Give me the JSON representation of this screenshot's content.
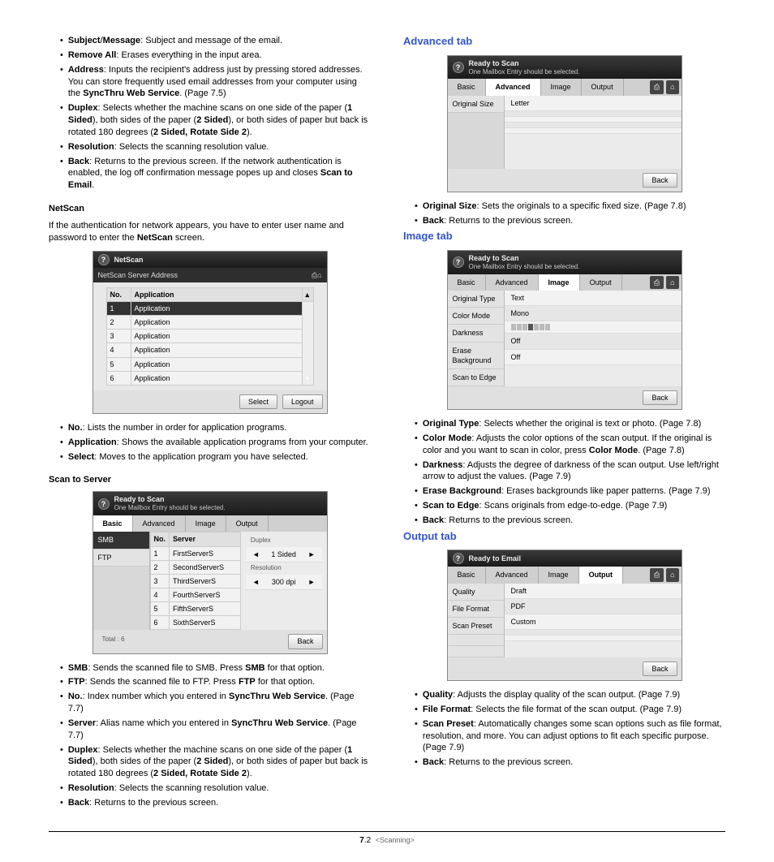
{
  "left": {
    "items_top": [
      {
        "t": "Subject",
        "s": "/",
        "t2": "Message",
        "rest": ": Subject and message of the email."
      },
      {
        "t": "Remove All",
        "rest": ": Erases everything in the input area."
      },
      {
        "t": "Address",
        "rest": ": Inputs the recipient's address just by pressing stored addresses. You can store frequently used email addresses from your computer using the ",
        "b2": "SyncThru Web Service",
        "tail": ". (Page 7.5)"
      },
      {
        "t": "Duplex",
        "rest": ": Selects whether the machine scans on one side of the paper (",
        "b2": "1 Sided",
        "r2": "), both sides of the paper (",
        "b3": "2 Sided",
        "r3": "), or both sides of paper but back is rotated 180 degrees (",
        "b4": "2 Sided, Rotate Side 2",
        "r4": ")."
      },
      {
        "t": "Resolution",
        "rest": ": Selects the scanning resolution value."
      },
      {
        "t": "Back",
        "rest": ": Returns to the previous screen. If the network authentication is enabled, the log off confirmation message popes up and closes ",
        "b2": "Scan to Email",
        "tail": "."
      }
    ],
    "netscan_h": "NetScan",
    "netscan_para": [
      "If the authentication for network appears, you have to enter user name and password to enter the ",
      "NetScan",
      " screen."
    ],
    "netscan_dlg": {
      "title": "NetScan",
      "sub": "NetScan Server Address",
      "col_no": "No.",
      "col_app": "Application",
      "rows": [
        "Application",
        "Application",
        "Application",
        "Application",
        "Application",
        "Application"
      ],
      "btn_select": "Select",
      "btn_logout": "Logout"
    },
    "netscan_items": [
      {
        "t": "No.",
        "rest": ": Lists the number in order for application programs."
      },
      {
        "t": "Application",
        "rest": ": Shows the available application programs from your computer."
      },
      {
        "t": "Select",
        "rest": ": Moves to the application program you have selected."
      }
    ],
    "scan_server_h": "Scan to Server",
    "scan_server_dlg": {
      "title": "Ready to Scan",
      "sub": "One Mailbox Entry should be selected.",
      "tabs": [
        "Basic",
        "Advanced",
        "Image",
        "Output"
      ],
      "side": [
        {
          "l": "SMB",
          "sel": true
        },
        {
          "l": "FTP"
        }
      ],
      "col_no": "No.",
      "col_server": "Server",
      "rows": [
        "FirstServerS",
        "SecondServerS",
        "ThirdServerS",
        "FourthServerS",
        "FifthServerS",
        "SixthServerS"
      ],
      "duplex_l": "Duplex",
      "duplex_v": "1 Sided",
      "res_l": "Resolution",
      "res_v": "300 dpi",
      "total": "Total : 6",
      "btn_back": "Back"
    },
    "scan_server_items": [
      {
        "t": "SMB",
        "rest": ": Sends the scanned file to SMB. Press ",
        "b2": "SMB",
        "tail": " for that option."
      },
      {
        "t": "FTP",
        "rest": ": Sends the scanned file to FTP. Press ",
        "b2": "FTP",
        "tail": " for that option."
      },
      {
        "t": "No.",
        "rest": ": Index number which you entered in ",
        "b2": "SyncThru Web Service",
        "tail": ". (Page 7.7)"
      },
      {
        "t": "Server",
        "rest": ": Alias name which you entered in ",
        "b2": "SyncThru Web Service",
        "tail": ". (Page 7.7)"
      },
      {
        "t": "Duplex",
        "rest": ": Selects whether the machine scans on one side of the paper (",
        "b2": "1 Sided",
        "r2": "), both sides of the paper (",
        "b3": "2 Sided",
        "r3": "), or both sides of paper but back is rotated 180 degrees (",
        "b4": "2 Sided, Rotate Side 2",
        "r4": ")."
      },
      {
        "t": "Resolution",
        "rest": ": Selects the scanning resolution value."
      },
      {
        "t": "Back",
        "rest": ": Returns to the previous screen."
      }
    ]
  },
  "right": {
    "adv_h": "Advanced tab",
    "adv_dlg": {
      "title": "Ready to Scan",
      "sub": "One Mailbox Entry should be selected.",
      "tabs": [
        "Basic",
        "Advanced",
        "Image",
        "Output"
      ],
      "side": [
        {
          "l": "Original Size"
        }
      ],
      "val": "Letter",
      "btn_back": "Back"
    },
    "adv_items": [
      {
        "t": "Original Size",
        "rest": ": Sets the originals to a specific fixed size. (Page 7.8)"
      },
      {
        "t": "Back",
        "rest": ": Returns to the previous screen."
      }
    ],
    "img_h": "Image tab",
    "img_dlg": {
      "title": "Ready to Scan",
      "sub": "One Mailbox Entry should be selected.",
      "tabs": [
        "Basic",
        "Advanced",
        "Image",
        "Output"
      ],
      "rows": [
        {
          "l": "Original Type",
          "v": "Text",
          "icon": "doc"
        },
        {
          "l": "Color Mode",
          "v": "Mono"
        },
        {
          "l": "Darkness",
          "v": "bars"
        },
        {
          "l": "Erase Background",
          "v": "Off"
        },
        {
          "l": "Scan to Edge",
          "v": "Off"
        }
      ],
      "btn_back": "Back"
    },
    "img_items": [
      {
        "t": "Original Type",
        "rest": ": Selects whether the original is text or photo. (Page 7.8)"
      },
      {
        "t": "Color Mode",
        "rest": ": Adjusts the color options of the scan output. If the original is color and you want to scan in color, press ",
        "b2": "Color Mode",
        "tail": ". (Page 7.8)"
      },
      {
        "t": "Darkness",
        "rest": ": Adjusts the degree of darkness of the scan output. Use left/right arrow to adjust the values. (Page 7.9)"
      },
      {
        "t": "Erase Background",
        "rest": ": Erases backgrounds like paper patterns. (Page 7.9)"
      },
      {
        "t": "Scan to Edge",
        "rest": ": Scans originals from edge-to-edge. (Page 7.9)"
      },
      {
        "t": "Back",
        "rest": ": Returns to the previous screen."
      }
    ],
    "out_h": "Output tab",
    "out_dlg": {
      "title": "Ready to Email",
      "tabs": [
        "Basic",
        "Advanced",
        "Image",
        "Output"
      ],
      "rows": [
        {
          "l": "Quality",
          "v": "Draft"
        },
        {
          "l": "File Format",
          "v": "PDF"
        },
        {
          "l": "Scan Preset",
          "v": "Custom"
        }
      ],
      "btn_back": "Back"
    },
    "out_items": [
      {
        "t": "Quality",
        "rest": ": Adjusts the display quality of the scan output. (Page 7.9)"
      },
      {
        "t": "File Format",
        "rest": ": Selects the file format of the scan output. (Page 7.9)"
      },
      {
        "t": "Scan Preset",
        "rest": ": Automatically changes some scan options such as file format, resolution, and more. You can adjust options to fit each specific purpose. (Page 7.9)"
      },
      {
        "t": "Back",
        "rest": ": Returns to the previous screen."
      }
    ]
  },
  "footer": {
    "page": "7",
    "sub": ".2",
    "section": "<Scanning>"
  }
}
